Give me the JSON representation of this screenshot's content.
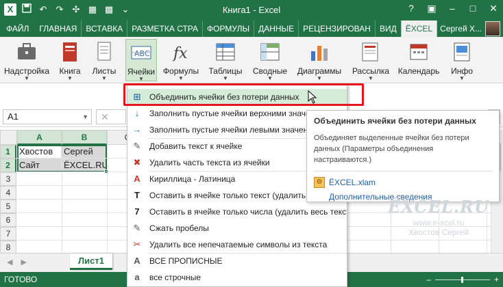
{
  "window": {
    "title": "Книга1 - Excel",
    "qat_logo": "X",
    "qat_icons": [
      "save-icon",
      "undo-icon",
      "redo-icon",
      "addin-icon",
      "addin2-icon",
      "addin3-icon",
      "customize-icon"
    ],
    "help": "?",
    "min": "–",
    "max": "□",
    "close": "✕"
  },
  "tabs": [
    {
      "label": "ФАЙЛ",
      "kind": "file"
    },
    {
      "label": "ГЛАВНАЯ"
    },
    {
      "label": "ВСТАВКА"
    },
    {
      "label": "РАЗМЕТКА СТРА"
    },
    {
      "label": "ФОРМУЛЫ"
    },
    {
      "label": "ДАННЫЕ"
    },
    {
      "label": "РЕЦЕНЗИРОВАН"
    },
    {
      "label": "ВИД"
    },
    {
      "label": "ЁXCEL",
      "kind": "active"
    }
  ],
  "user": {
    "name": "Сергей Х..."
  },
  "ribbon": [
    {
      "label": "Надстройка",
      "icon": "briefcase-icon",
      "has_arrow": true
    },
    {
      "label": "Книга",
      "icon": "book-icon",
      "has_arrow": true
    },
    {
      "label": "Листы",
      "icon": "sheets-icon",
      "has_arrow": true
    },
    {
      "label": "Ячейки",
      "icon": "cells-icon",
      "has_arrow": true,
      "pressed": true
    },
    {
      "label": "Формулы",
      "icon": "fx-icon",
      "has_arrow": true
    },
    {
      "label": "Таблицы",
      "icon": "tables-icon",
      "has_arrow": true
    },
    {
      "label": "Сводные",
      "icon": "pivot-icon",
      "has_arrow": true
    },
    {
      "label": "Диаграммы",
      "icon": "chart-icon",
      "has_arrow": true
    },
    {
      "label": "Рассылка",
      "icon": "mail-icon",
      "has_arrow": true
    },
    {
      "label": "Календарь",
      "icon": "calendar-icon",
      "has_arrow": false
    },
    {
      "label": "Инфо",
      "icon": "info-icon",
      "has_arrow": true
    }
  ],
  "formula_bar": {
    "namebox": "A1",
    "cancel": "✕",
    "expand": "⌄"
  },
  "grid": {
    "columns": [
      "A",
      "B",
      "C"
    ],
    "rows": [
      "1",
      "2",
      "3",
      "4",
      "5",
      "6",
      "7",
      "8"
    ],
    "cells": {
      "A1": "Хвостов",
      "B1": "Сергей",
      "A2": "Сайт",
      "B2": "ЁXCEL.RU"
    }
  },
  "menu": [
    {
      "label": "Объединить ячейки без потери данных",
      "icon": "merge-icon",
      "glyph": "⊞",
      "highlighted": true
    },
    {
      "label": "Заполнить пустые ячейки верхними значениями",
      "icon": "fill-down-icon",
      "glyph": "↓"
    },
    {
      "label": "Заполнить пустые ячейки левыми значениями",
      "icon": "fill-right-icon",
      "glyph": "→"
    },
    {
      "label": "Добавить текст к ячейке",
      "icon": "add-text-icon",
      "glyph": "✎"
    },
    {
      "label": "Удалить часть текста из ячейки",
      "icon": "remove-text-icon",
      "glyph": "✖"
    },
    {
      "label": "Кириллица - Латиница",
      "icon": "translit-icon",
      "glyph": "A"
    },
    {
      "label": "Оставить в ячейке только текст (удалить все числа)",
      "icon": "text-only-icon",
      "glyph": "T"
    },
    {
      "label": "Оставить в ячейке только числа (удалить весь текст)",
      "icon": "numbers-only-icon",
      "glyph": "7"
    },
    {
      "label": "Сжать пробелы",
      "icon": "trim-spaces-icon",
      "glyph": "✎"
    },
    {
      "label": "Удалить все непечатаемые символы из текста",
      "icon": "clean-icon",
      "glyph": "✂"
    },
    {
      "label": "ВСЕ ПРОПИСНЫЕ",
      "icon": "uppercase-icon",
      "glyph": "A"
    },
    {
      "label": "все строчные",
      "icon": "lowercase-icon",
      "glyph": "a"
    }
  ],
  "tooltip": {
    "title": "Объединить ячейки без потери данных",
    "description": "Объединяет выделенные ячейки без потери данных (Параметры объединения настраиваются.)",
    "file": "ЁXCEL.xlam",
    "more": "Дополнительные сведения"
  },
  "watermark": {
    "logo": "ЁXCEL.RU",
    "url": "www.e-xcel.ru",
    "author": "Хвостов Сергей"
  },
  "sheet": {
    "tab": "Лист1",
    "nav_prev": "◀",
    "nav_next": "▶"
  },
  "status": {
    "text": "ГОТОВО",
    "zoom_minus": "–",
    "zoom_plus": "+"
  },
  "colors": {
    "accent": "#217346",
    "highlight": "#d5ecd9",
    "callout": "#e8131e"
  }
}
